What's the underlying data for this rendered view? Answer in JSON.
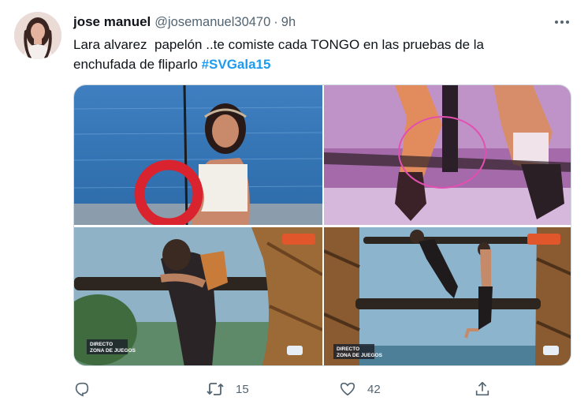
{
  "tweet": {
    "author_name": "jose manuel",
    "author_handle": "@josemanuel30470",
    "separator": "·",
    "timestamp": "9h",
    "text_line1": "Lara alvarez  papelón ..te comiste cada TONGO en las pruebas de la",
    "text_line2": "enchufada de fliparlo ",
    "hashtag": "#SVGala15"
  },
  "media": {
    "overlay_label_line1": "DIRECTO",
    "overlay_label_line2": "ZONA DE JUEGOS"
  },
  "actions": {
    "reply_icon": "reply-icon",
    "retweet_icon": "retweet-icon",
    "retweet_count": "15",
    "like_icon": "heart-icon",
    "like_count": "42",
    "share_icon": "share-icon"
  },
  "colors": {
    "text_primary": "#0f1419",
    "text_secondary": "#536471",
    "hashtag": "#1d9bf0",
    "border": "#cfd9de",
    "red_circle": "#d9232e",
    "pink_circle": "#e24fb0"
  }
}
